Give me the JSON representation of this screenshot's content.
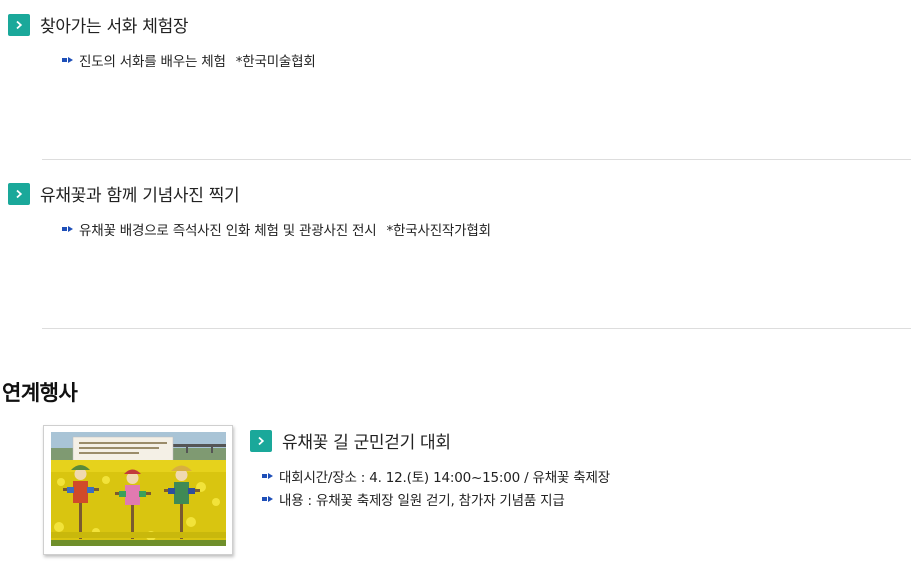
{
  "programs": [
    {
      "title": "찾아가는 서화 체험장",
      "description": "진도의 서화를 배우는 체험",
      "organizer": "*한국미술협회"
    },
    {
      "title": "유채꽃과 함께 기념사진 찍기",
      "description": "유채꽃 배경으로 즉석사진 인화 체험 및 관광사진 전시",
      "organizer": "*한국사진작가협회"
    }
  ],
  "linked_events": {
    "heading": "연계행사",
    "event": {
      "title": "유채꽃 길 군민걷기 대회",
      "details": [
        "대회시간/장소 : 4. 12.(토) 14:00~15:00 / 유채꽃 축제장",
        "내용 : 유채꽃 축제장 일원 걷기, 참가자 기념품 지급"
      ],
      "photo_icon": "canola-field-scarecrows-photo"
    }
  },
  "colors": {
    "accent": "#1aa89a",
    "bullet": "#1e4fb8",
    "divider": "#dddddd"
  }
}
